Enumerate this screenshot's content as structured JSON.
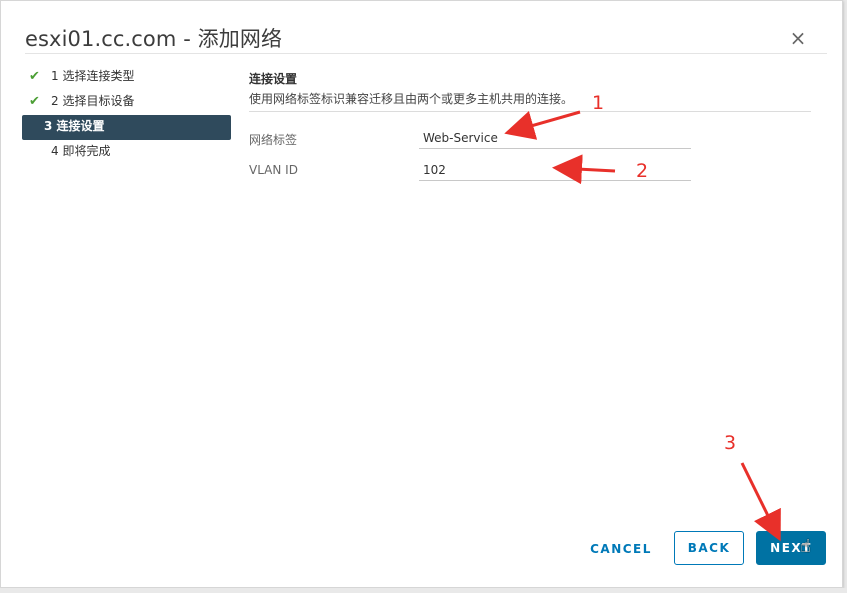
{
  "dialog": {
    "title": "esxi01.cc.com - 添加网络",
    "close_glyph": "×"
  },
  "steps": [
    {
      "label": "1 选择连接类型",
      "state": "completed"
    },
    {
      "label": "2 选择目标设备",
      "state": "completed"
    },
    {
      "label": "3 连接设置",
      "state": "active"
    },
    {
      "label": "4 即将完成",
      "state": "pending"
    }
  ],
  "check_glyph": "✔",
  "section": {
    "title": "连接设置",
    "description": "使用网络标签标识兼容迁移且由两个或更多主机共用的连接。"
  },
  "fields": {
    "network_label": {
      "label": "网络标签",
      "value": "Web-Service"
    },
    "vlan_id": {
      "label": "VLAN ID",
      "value": "102"
    }
  },
  "buttons": {
    "cancel": "CANCEL",
    "back": "BACK",
    "next": "NEXT"
  },
  "annotations": {
    "one": "1",
    "two": "2",
    "three": "3",
    "color": "#e8302a"
  },
  "colors": {
    "accent": "#0079b8",
    "primary_button": "#0072a3",
    "active_step": "#2f4a5c",
    "check": "#4b9e34"
  }
}
